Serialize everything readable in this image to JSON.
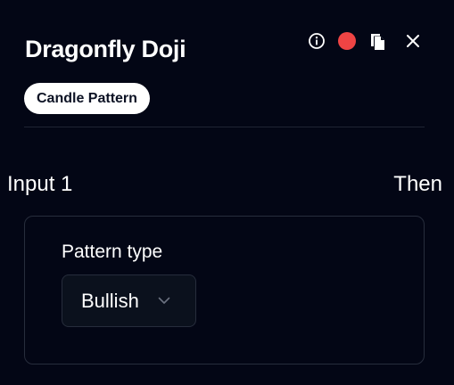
{
  "node": {
    "title": "Dragonfly Doji",
    "category_badge": "Candle Pattern"
  },
  "toolbar": {
    "info_icon": "info-circle-icon",
    "status_icon": "red-status-dot",
    "copy_icon": "copy-icon",
    "close_icon": "close-x-icon",
    "status_color": "#ef4444"
  },
  "ports": {
    "input_label": "Input 1",
    "output_label": "Then"
  },
  "settings": {
    "pattern_type_label": "Pattern type",
    "pattern_type_value": "Bullish"
  },
  "colors": {
    "background": "#030615",
    "card_border": "#272d3c",
    "select_background": "#0b111d",
    "badge_background": "#ffffff",
    "badge_text": "#0c1224"
  }
}
